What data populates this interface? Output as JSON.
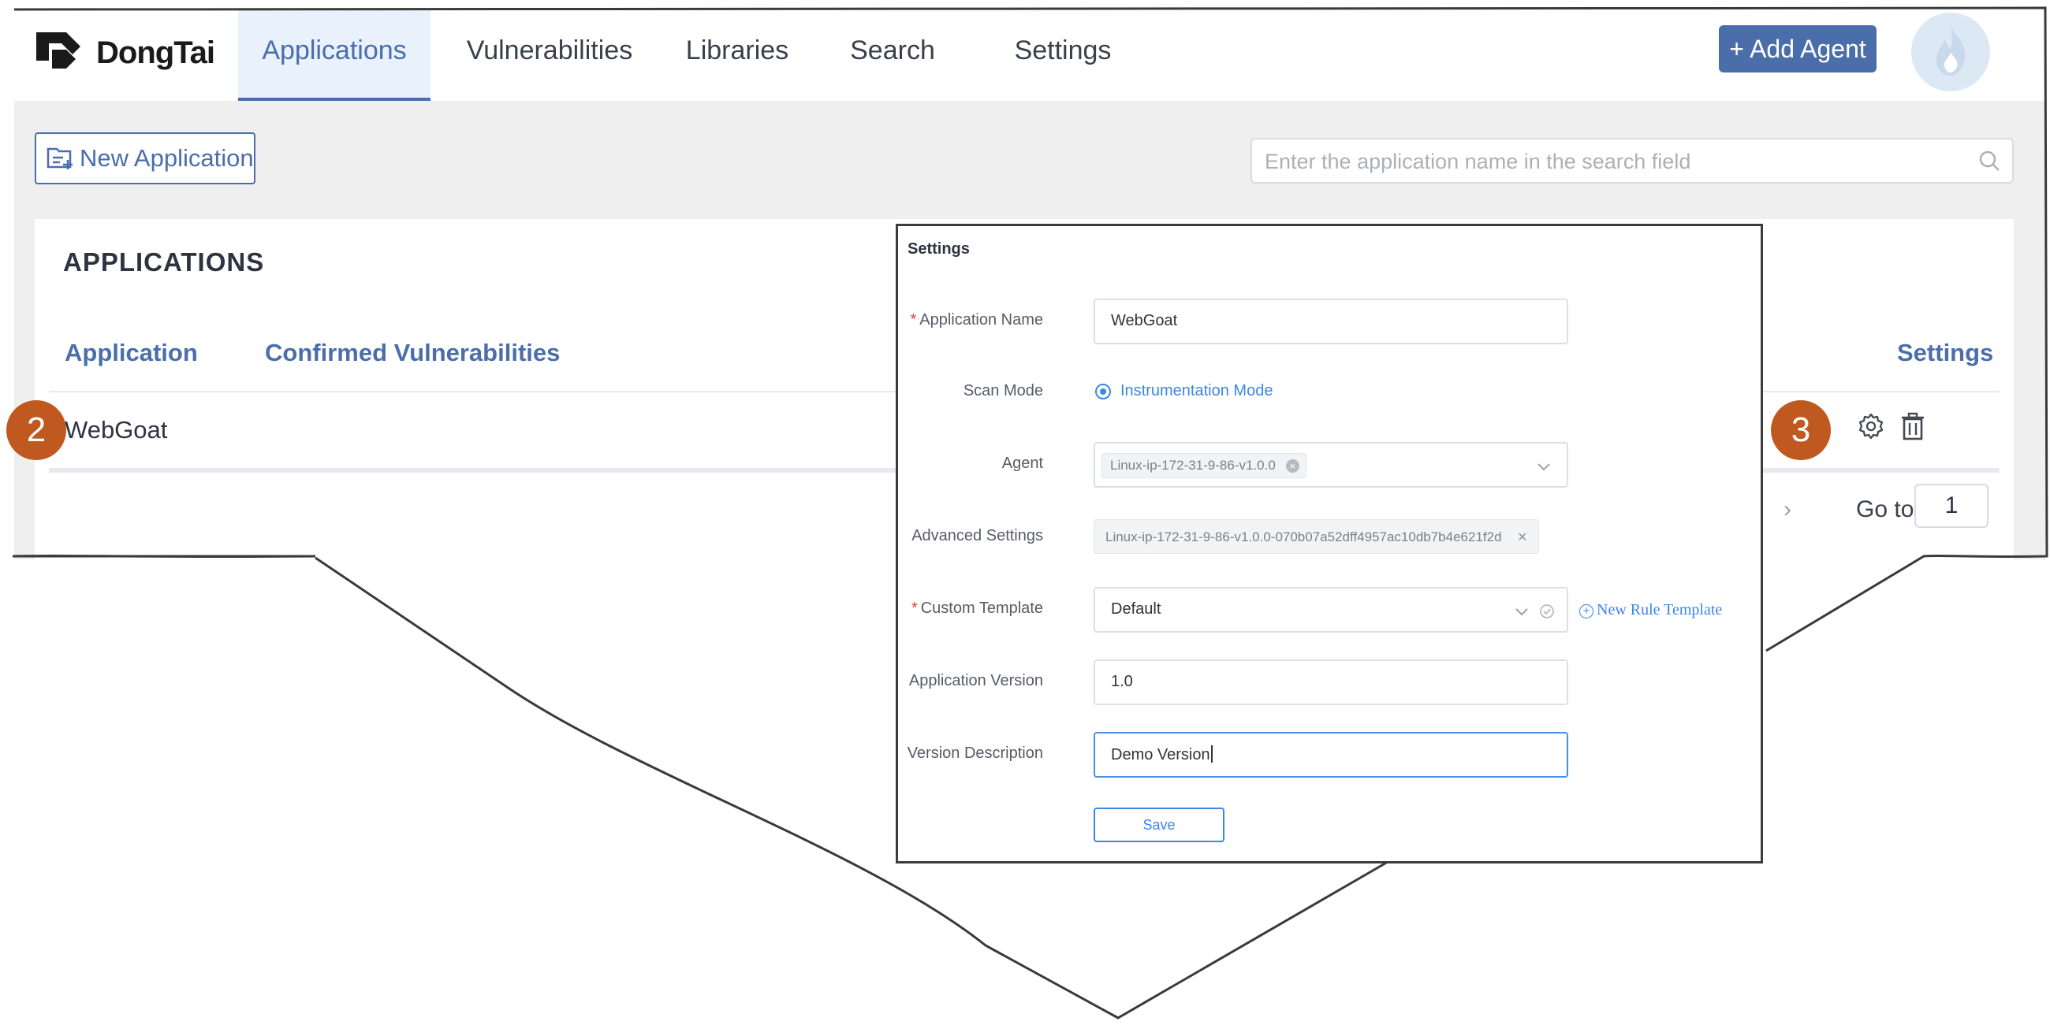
{
  "brand": {
    "name": "DongTai"
  },
  "nav": {
    "tabs": [
      {
        "label": "Applications",
        "active": true
      },
      {
        "label": "Vulnerabilities"
      },
      {
        "label": "Libraries"
      },
      {
        "label": "Search"
      },
      {
        "label": "Settings"
      }
    ],
    "add_agent_label": "+ Add Agent",
    "avatar_icon": "flame-icon"
  },
  "toolbar": {
    "new_application_label": "New Application",
    "search_placeholder": "Enter the application name in the search field"
  },
  "applications": {
    "section_title": "APPLICATIONS",
    "columns": {
      "application": "Application",
      "confirmed": "Confirmed Vulnerabilities",
      "settings": "Settings"
    },
    "rows": [
      {
        "name": "WebGoat",
        "actions": [
          "gear-icon",
          "trash-icon"
        ]
      }
    ],
    "pagination": {
      "goto_label": "Go to",
      "page": "1"
    }
  },
  "callouts": {
    "app_badge": "2",
    "settings_badge": "3"
  },
  "settings_dialog": {
    "title": "Settings",
    "app_name_label": "Application Name",
    "app_name_value": "WebGoat",
    "scan_mode_label": "Scan Mode",
    "scan_mode_value": "Instrumentation Mode",
    "agent_label": "Agent",
    "agent_tag": "Linux-ip-172-31-9-86-v1.0.0",
    "advanced_label": "Advanced Settings",
    "advanced_tag": "Linux-ip-172-31-9-86-v1.0.0-070b07a52dff4957ac10db7b4e621f2d",
    "template_label": "Custom Template",
    "template_value": "Default",
    "new_rule_label": "New Rule Template",
    "version_label": "Application Version",
    "version_value": "1.0",
    "description_label": "Version Description",
    "description_value": "Demo Version",
    "save_label": "Save"
  },
  "colors": {
    "accent": "#4a6ea9",
    "link": "#3b86e8",
    "badge": "#c0591f",
    "required": "#e0453a"
  }
}
